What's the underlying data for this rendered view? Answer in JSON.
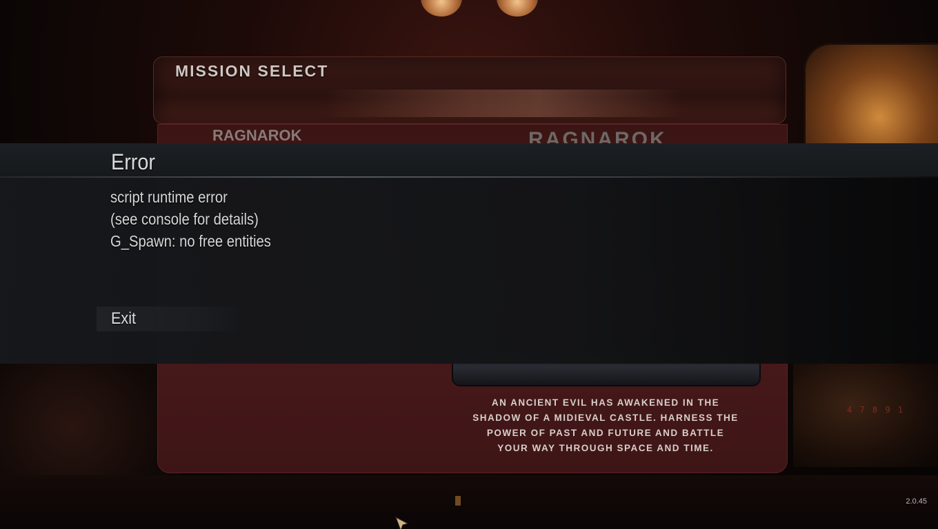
{
  "background": {
    "menu_title": "MISSION SELECT",
    "mission_list_item": "RAGNAROK",
    "mission_name": "RAGNAROK",
    "mission_description_lines": [
      "AN ANCIENT EVIL HAS AWAKENED IN THE",
      "SHADOW OF A MIDIEVAL CASTLE. HARNESS THE",
      "POWER OF PAST AND FUTURE AND BATTLE",
      "YOUR WAY THROUGH SPACE AND TIME."
    ],
    "counter_text": "4 7 8 9 1"
  },
  "error_dialog": {
    "title": "Error",
    "lines": [
      "script runtime error",
      "(see console for details)",
      "G_Spawn: no free entities"
    ],
    "exit_label": "Exit"
  },
  "version": "2.0.45",
  "colors": {
    "dialog_background": "#141619",
    "text": "#d6d6d6",
    "menu_panel": "#3a1514",
    "accent_window": "#d08a3c"
  },
  "icons": {
    "cursor": "arrow-cursor-icon"
  }
}
